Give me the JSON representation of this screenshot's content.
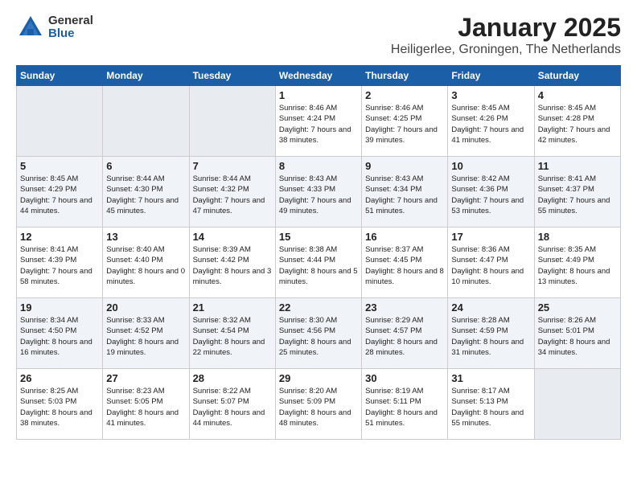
{
  "logo": {
    "general": "General",
    "blue": "Blue"
  },
  "title": {
    "month": "January 2025",
    "location": "Heiligerlee, Groningen, The Netherlands"
  },
  "weekdays": [
    "Sunday",
    "Monday",
    "Tuesday",
    "Wednesday",
    "Thursday",
    "Friday",
    "Saturday"
  ],
  "rows": [
    {
      "shaded": false,
      "cells": [
        {
          "day": "",
          "info": "",
          "empty": true
        },
        {
          "day": "",
          "info": "",
          "empty": true
        },
        {
          "day": "",
          "info": "",
          "empty": true
        },
        {
          "day": "1",
          "info": "Sunrise: 8:46 AM\nSunset: 4:24 PM\nDaylight: 7 hours\nand 38 minutes."
        },
        {
          "day": "2",
          "info": "Sunrise: 8:46 AM\nSunset: 4:25 PM\nDaylight: 7 hours\nand 39 minutes."
        },
        {
          "day": "3",
          "info": "Sunrise: 8:45 AM\nSunset: 4:26 PM\nDaylight: 7 hours\nand 41 minutes."
        },
        {
          "day": "4",
          "info": "Sunrise: 8:45 AM\nSunset: 4:28 PM\nDaylight: 7 hours\nand 42 minutes."
        }
      ]
    },
    {
      "shaded": true,
      "cells": [
        {
          "day": "5",
          "info": "Sunrise: 8:45 AM\nSunset: 4:29 PM\nDaylight: 7 hours\nand 44 minutes."
        },
        {
          "day": "6",
          "info": "Sunrise: 8:44 AM\nSunset: 4:30 PM\nDaylight: 7 hours\nand 45 minutes."
        },
        {
          "day": "7",
          "info": "Sunrise: 8:44 AM\nSunset: 4:32 PM\nDaylight: 7 hours\nand 47 minutes."
        },
        {
          "day": "8",
          "info": "Sunrise: 8:43 AM\nSunset: 4:33 PM\nDaylight: 7 hours\nand 49 minutes."
        },
        {
          "day": "9",
          "info": "Sunrise: 8:43 AM\nSunset: 4:34 PM\nDaylight: 7 hours\nand 51 minutes."
        },
        {
          "day": "10",
          "info": "Sunrise: 8:42 AM\nSunset: 4:36 PM\nDaylight: 7 hours\nand 53 minutes."
        },
        {
          "day": "11",
          "info": "Sunrise: 8:41 AM\nSunset: 4:37 PM\nDaylight: 7 hours\nand 55 minutes."
        }
      ]
    },
    {
      "shaded": false,
      "cells": [
        {
          "day": "12",
          "info": "Sunrise: 8:41 AM\nSunset: 4:39 PM\nDaylight: 7 hours\nand 58 minutes."
        },
        {
          "day": "13",
          "info": "Sunrise: 8:40 AM\nSunset: 4:40 PM\nDaylight: 8 hours\nand 0 minutes."
        },
        {
          "day": "14",
          "info": "Sunrise: 8:39 AM\nSunset: 4:42 PM\nDaylight: 8 hours\nand 3 minutes."
        },
        {
          "day": "15",
          "info": "Sunrise: 8:38 AM\nSunset: 4:44 PM\nDaylight: 8 hours\nand 5 minutes."
        },
        {
          "day": "16",
          "info": "Sunrise: 8:37 AM\nSunset: 4:45 PM\nDaylight: 8 hours\nand 8 minutes."
        },
        {
          "day": "17",
          "info": "Sunrise: 8:36 AM\nSunset: 4:47 PM\nDaylight: 8 hours\nand 10 minutes."
        },
        {
          "day": "18",
          "info": "Sunrise: 8:35 AM\nSunset: 4:49 PM\nDaylight: 8 hours\nand 13 minutes."
        }
      ]
    },
    {
      "shaded": true,
      "cells": [
        {
          "day": "19",
          "info": "Sunrise: 8:34 AM\nSunset: 4:50 PM\nDaylight: 8 hours\nand 16 minutes."
        },
        {
          "day": "20",
          "info": "Sunrise: 8:33 AM\nSunset: 4:52 PM\nDaylight: 8 hours\nand 19 minutes."
        },
        {
          "day": "21",
          "info": "Sunrise: 8:32 AM\nSunset: 4:54 PM\nDaylight: 8 hours\nand 22 minutes."
        },
        {
          "day": "22",
          "info": "Sunrise: 8:30 AM\nSunset: 4:56 PM\nDaylight: 8 hours\nand 25 minutes."
        },
        {
          "day": "23",
          "info": "Sunrise: 8:29 AM\nSunset: 4:57 PM\nDaylight: 8 hours\nand 28 minutes."
        },
        {
          "day": "24",
          "info": "Sunrise: 8:28 AM\nSunset: 4:59 PM\nDaylight: 8 hours\nand 31 minutes."
        },
        {
          "day": "25",
          "info": "Sunrise: 8:26 AM\nSunset: 5:01 PM\nDaylight: 8 hours\nand 34 minutes."
        }
      ]
    },
    {
      "shaded": false,
      "cells": [
        {
          "day": "26",
          "info": "Sunrise: 8:25 AM\nSunset: 5:03 PM\nDaylight: 8 hours\nand 38 minutes."
        },
        {
          "day": "27",
          "info": "Sunrise: 8:23 AM\nSunset: 5:05 PM\nDaylight: 8 hours\nand 41 minutes."
        },
        {
          "day": "28",
          "info": "Sunrise: 8:22 AM\nSunset: 5:07 PM\nDaylight: 8 hours\nand 44 minutes."
        },
        {
          "day": "29",
          "info": "Sunrise: 8:20 AM\nSunset: 5:09 PM\nDaylight: 8 hours\nand 48 minutes."
        },
        {
          "day": "30",
          "info": "Sunrise: 8:19 AM\nSunset: 5:11 PM\nDaylight: 8 hours\nand 51 minutes."
        },
        {
          "day": "31",
          "info": "Sunrise: 8:17 AM\nSunset: 5:13 PM\nDaylight: 8 hours\nand 55 minutes."
        },
        {
          "day": "",
          "info": "",
          "empty": true
        }
      ]
    }
  ]
}
